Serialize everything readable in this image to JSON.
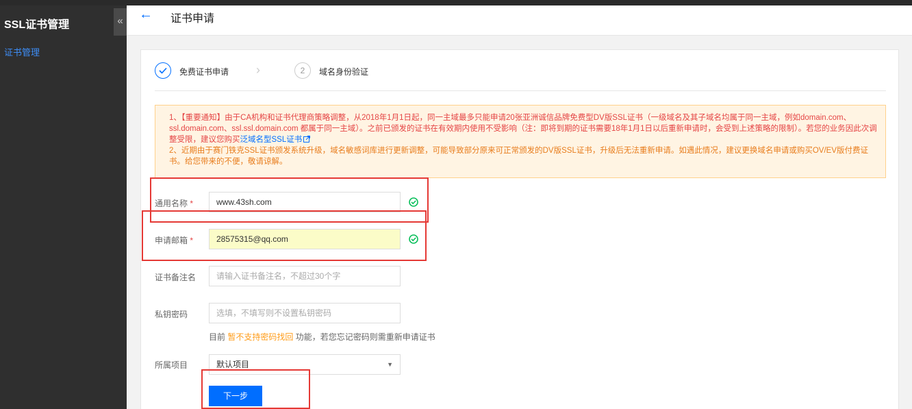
{
  "sidebar": {
    "title": "SSL证书管理",
    "collapse_icon": "«",
    "items": [
      {
        "label": "证书管理"
      }
    ]
  },
  "header": {
    "back_icon": "←",
    "title": "证书申请"
  },
  "steps": [
    {
      "label": "免费证书申请",
      "state": "done"
    },
    {
      "number": "2",
      "label": "域名身份验证",
      "state": "pending"
    }
  ],
  "step_separator": "›",
  "notice": {
    "line1_a": "1、【重要通知】由于CA机构和证书代理商策略调整，从2018年1月1日起，同一主域最多只能申请20张亚洲诚信品牌免费型DV版SSL证书（一级域名及其子域名均属于同一主域，例如domain.com、ssl.domain.com、ssl.ssl.domain.com 都属于同一主域）。之前已颁发的证书在有效期内使用不受影响（注：即将到期的证书需要18年1月1日以后重新申请时，会受到上述策略的限制）。若您的业务因此次调整受限，建议您购买",
    "link": "泛域名型SSL证书",
    "line2": "2、近期由于赛门铁克SSL证书颁发系统升级，域名敏感词库进行更新调整，可能导致部分原来可正常颁发的DV版SSL证书，升级后无法重新申请。如遇此情况，建议更换域名申请或购买OV/EV版付费证书。给您带来的不便，敬请谅解。"
  },
  "form": {
    "common_name": {
      "label": "通用名称",
      "required_mark": "*",
      "value": "www.43sh.com"
    },
    "email": {
      "label": "申请邮箱",
      "required_mark": "*",
      "value": "28575315@qq.com"
    },
    "remark": {
      "label": "证书备注名",
      "placeholder": "请输入证书备注名，不超过30个字"
    },
    "private_key": {
      "label": "私钥密码",
      "placeholder": "选填，不填写则不设置私钥密码"
    },
    "hint": {
      "prefix": "目前 ",
      "highlight": "暂不支持密码找回",
      "suffix": " 功能，若您忘记密码则需重新申请证书"
    },
    "project": {
      "label": "所属项目",
      "value": "默认项目",
      "arrow": "▼"
    },
    "next_button": "下一步"
  },
  "colors": {
    "primary": "#006eff",
    "success": "#0abf5b",
    "warning": "#ff9c19",
    "error": "#e54545",
    "annotation": "#e53935"
  }
}
